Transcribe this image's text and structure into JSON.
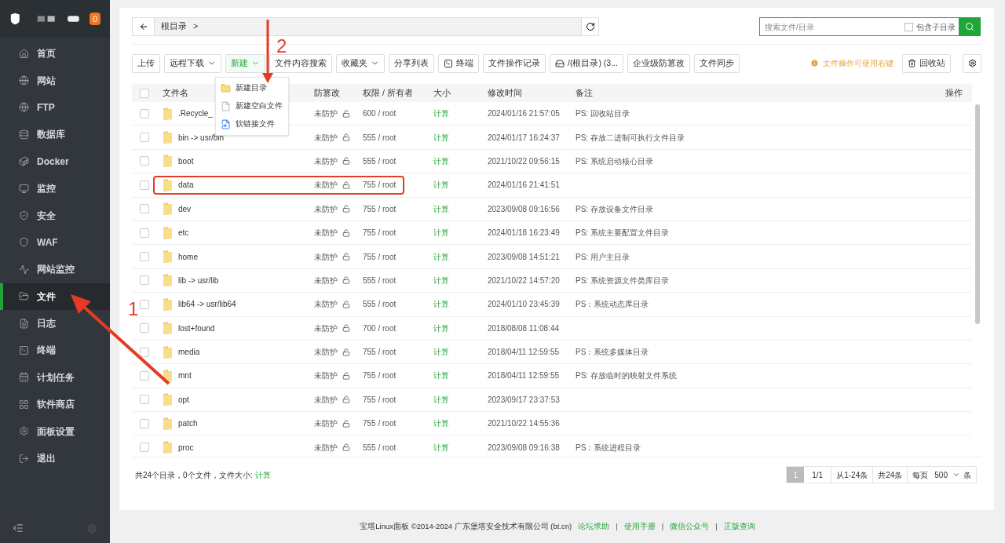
{
  "sidebar": {
    "badge": "0",
    "items": [
      {
        "label": "首页",
        "selected": false
      },
      {
        "label": "网站",
        "selected": false
      },
      {
        "label": "FTP",
        "selected": false
      },
      {
        "label": "数据库",
        "selected": false
      },
      {
        "label": "Docker",
        "selected": false
      },
      {
        "label": "监控",
        "selected": false
      },
      {
        "label": "安全",
        "selected": false
      },
      {
        "label": "WAF",
        "selected": false
      },
      {
        "label": "网站监控",
        "selected": false
      },
      {
        "label": "文件",
        "selected": true
      },
      {
        "label": "日志",
        "selected": false
      },
      {
        "label": "终端",
        "selected": false
      },
      {
        "label": "计划任务",
        "selected": false
      },
      {
        "label": "软件商店",
        "selected": false
      },
      {
        "label": "面板设置",
        "selected": false
      },
      {
        "label": "退出",
        "selected": false
      }
    ]
  },
  "breadcrumb": {
    "path": "根目录",
    "separator": ">"
  },
  "search": {
    "placeholder": "搜索文件/目录",
    "subdir_label": "包含子目录",
    "subdir_checked": false
  },
  "toolbar": [
    {
      "label": "上传",
      "kind": "plain",
      "active": false
    },
    {
      "label": "远程下载",
      "kind": "dropdown",
      "active": false
    },
    {
      "label": "新建",
      "kind": "dropdown",
      "active": true
    },
    {
      "label": "文件内容搜索",
      "kind": "plain",
      "active": false
    },
    {
      "label": "收藏夹",
      "kind": "dropdown",
      "active": false
    },
    {
      "label": "分享列表",
      "kind": "plain",
      "active": false
    },
    {
      "label": "终端",
      "kind": "terminal",
      "active": false
    },
    {
      "label": "文件操作记录",
      "kind": "plain",
      "active": false
    },
    {
      "label": "/(根目录) (3...",
      "kind": "disk",
      "active": false
    },
    {
      "label": "企业级防篡改",
      "kind": "plain",
      "active": false
    },
    {
      "label": "文件同步",
      "kind": "plain",
      "active": false
    }
  ],
  "hint": "文件操作可使用右键",
  "recycle_button": "回收站",
  "new_menu": [
    {
      "label": "新建目录",
      "kind": "folder"
    },
    {
      "label": "新建空白文件",
      "kind": "file"
    },
    {
      "label": "软链接文件",
      "kind": "link"
    }
  ],
  "table": {
    "header_checked": false,
    "columns": [
      "文件名",
      "防篡改",
      "权限 / 所有者",
      "大小",
      "修改时间",
      "备注",
      "操作"
    ],
    "rows": [
      {
        "name": ".Recycle_",
        "protect": "未防护",
        "perm": "600 / root",
        "size": "计算",
        "mtime": "2024/01/16 21:57:05",
        "note": "PS: 回收站目录",
        "checked": false,
        "marked": false
      },
      {
        "name": "bin -> usr/bin",
        "protect": "未防护",
        "perm": "555 / root",
        "size": "计算",
        "mtime": "2024/01/17 16:24:37",
        "note": "PS: 存放二进制可执行文件目录",
        "checked": false,
        "marked": false
      },
      {
        "name": "boot",
        "protect": "未防护",
        "perm": "555 / root",
        "size": "计算",
        "mtime": "2021/10/22 09:56:15",
        "note": "PS: 系统启动核心目录",
        "checked": false,
        "marked": false
      },
      {
        "name": "data",
        "protect": "未防护",
        "perm": "755 / root",
        "size": "计算",
        "mtime": "2024/01/16 21:41:51",
        "checked": false,
        "marked": true
      },
      {
        "name": "dev",
        "protect": "未防护",
        "perm": "755 / root",
        "size": "计算",
        "mtime": "2023/09/08 09:16:56",
        "note": "PS: 存放设备文件目录",
        "checked": false,
        "marked": false
      },
      {
        "name": "etc",
        "protect": "未防护",
        "perm": "755 / root",
        "size": "计算",
        "mtime": "2024/01/18 16:23:49",
        "note": "PS: 系统主要配置文件目录",
        "checked": false,
        "marked": false
      },
      {
        "name": "home",
        "protect": "未防护",
        "perm": "755 / root",
        "size": "计算",
        "mtime": "2023/09/08 14:51:21",
        "note": "PS: 用户主目录",
        "checked": false,
        "marked": false
      },
      {
        "name": "lib -> usr/lib",
        "protect": "未防护",
        "perm": "555 / root",
        "size": "计算",
        "mtime": "2021/10/22 14:57:20",
        "note": "PS: 系统资源文件类库目录",
        "checked": false,
        "marked": false
      },
      {
        "name": "lib64 -> usr/lib64",
        "protect": "未防护",
        "perm": "555 / root",
        "size": "计算",
        "mtime": "2024/01/10 23:45:39",
        "note": "PS：系统动态库目录",
        "checked": false,
        "marked": false
      },
      {
        "name": "lost+found",
        "protect": "未防护",
        "perm": "700 / root",
        "size": "计算",
        "mtime": "2018/08/08 11:08:44",
        "checked": false,
        "marked": false
      },
      {
        "name": "media",
        "protect": "未防护",
        "perm": "755 / root",
        "size": "计算",
        "mtime": "2018/04/11 12:59:55",
        "note": "PS：系统多媒体目录",
        "checked": false,
        "marked": false
      },
      {
        "name": "mnt",
        "protect": "未防护",
        "perm": "755 / root",
        "size": "计算",
        "mtime": "2018/04/11 12:59:55",
        "note": "PS: 存放临时的映射文件系统",
        "checked": false,
        "marked": false
      },
      {
        "name": "opt",
        "protect": "未防护",
        "perm": "755 / root",
        "size": "计算",
        "mtime": "2023/09/17 23:37:53",
        "checked": false,
        "marked": false
      },
      {
        "name": "patch",
        "protect": "未防护",
        "perm": "755 / root",
        "size": "计算",
        "mtime": "2021/10/22 14:55:36",
        "checked": false,
        "marked": false
      },
      {
        "name": "proc",
        "protect": "未防护",
        "perm": "555 / root",
        "size": "计算",
        "mtime": "2023/09/08 09:16:38",
        "note": "PS：系统进程目录",
        "checked": false,
        "marked": false
      }
    ]
  },
  "summary": {
    "text": "共24个目录，0个文件，文件大小:",
    "link": "计算"
  },
  "pagination": {
    "pages": [
      {
        "label": "1",
        "selected": true
      }
    ],
    "page_of": "1/1",
    "range": "从1-24条",
    "total": "共24条",
    "per_page_label": "每页",
    "per_page": "500",
    "unit": "条"
  },
  "footer": {
    "copyright": "宝塔Linux面板 ©2014-2024 广东堡塔安全技术有限公司 (bt.cn)",
    "links": [
      "论坛求助",
      "使用手册",
      "微信公众号",
      "正版查询"
    ],
    "separator": "|"
  },
  "annotations": [
    {
      "label": "1"
    },
    {
      "label": "2"
    }
  ]
}
